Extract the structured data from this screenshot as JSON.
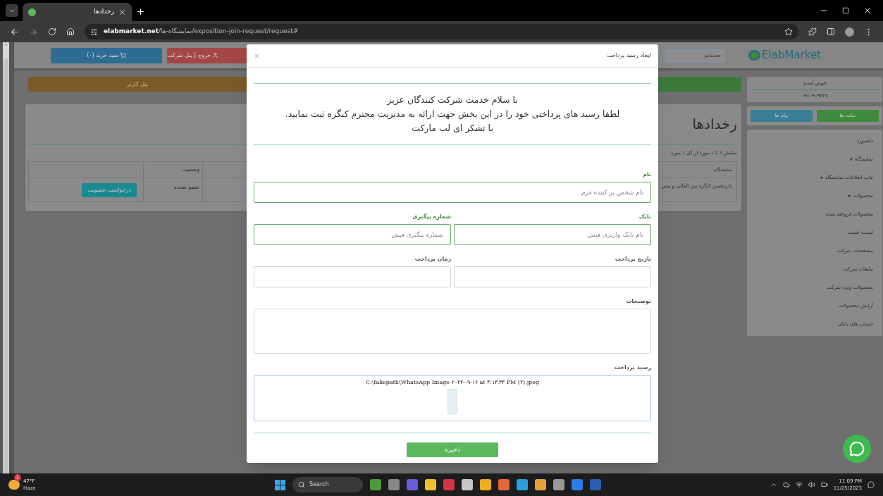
{
  "browser": {
    "tab_title": "رخدادها",
    "url_host": "elabmarket.net",
    "url_path": "/نمایشگاه-ها/exposition-join-request/request#"
  },
  "header": {
    "cart_button": "سبد خرید (۰)",
    "company_button": "خروج | پنل شرکت",
    "search": {
      "placeholder": "جستجو"
    },
    "logo": "ElabMarket"
  },
  "banner": {
    "label": "پنل کاربر"
  },
  "events": {
    "title": "رخدادها",
    "summary": "نمایش ۱ تا ۱ مورد از کل ۱ مورد.",
    "columns": [
      "نمایشگاه",
      "وضعیت"
    ],
    "rows": [
      {
        "status": "عضو نشده",
        "exhibition": "پانزدهمین کنگره بین المللی و بیس",
        "action": "درخواست عضویت"
      }
    ]
  },
  "sidebar": {
    "welcome": "خوش آمدید",
    "phone": "۰۹۱۰۹۰۹۲۲۷",
    "buttons": [
      {
        "label": "تیکت ها",
        "color": "#3f8a3c"
      },
      {
        "label": "پیام ها",
        "color": "#3a7f96"
      }
    ],
    "items": [
      {
        "label": "داشبورد",
        "has_submenu": false
      },
      {
        "label": "نمایشگاه",
        "has_submenu": true
      },
      {
        "label": "چاپ اطلاعات نمایشگاه",
        "has_submenu": true
      },
      {
        "label": "محصولات",
        "has_submenu": true
      },
      {
        "label": "محصولات فروخته شده",
        "has_submenu": false
      },
      {
        "label": "لیست قیمت",
        "has_submenu": false
      },
      {
        "label": "مشخصات شرکت",
        "has_submenu": false
      },
      {
        "label": "تبلیغات شرکت",
        "has_submenu": false
      },
      {
        "label": "محصولات ویژه شرکت",
        "has_submenu": false
      },
      {
        "label": "آرایش محصولات",
        "has_submenu": false
      },
      {
        "label": "حساب های بانکی",
        "has_submenu": false
      }
    ]
  },
  "modal": {
    "title": "ایجاد رسید پرداخت",
    "close": "×",
    "message": [
      "با سلام خدمت شرکت کنندگان عزیز",
      "لطفا رسید های پرداختی خود را در این بخش جهت ارائه به مدیریت محترم کنگره ثبت نمایید.",
      "با تشکر ای لب مارکت"
    ],
    "rows": [
      [
        {
          "kind": "text",
          "label": "نام",
          "placeholder": "نام شخص پر کننده فرم",
          "validated": true
        }
      ],
      [
        {
          "kind": "text",
          "label": "بانک",
          "placeholder": "نام بانک واریزی فیش",
          "validated": true
        },
        {
          "kind": "text",
          "label": "شماره پیگیری",
          "placeholder": "شماره پیگیری فیش",
          "validated": true
        }
      ],
      [
        {
          "kind": "text",
          "label": "تاریخ پرداخت",
          "validated": false
        },
        {
          "kind": "text",
          "label": "زمان پرداخت",
          "validated": false
        }
      ],
      [
        {
          "kind": "textarea",
          "label": "توضیحات",
          "validated": false
        }
      ],
      [
        {
          "kind": "file",
          "label": "رسید پرداخت",
          "value": "C:\\fakepath\\WhatsApp Image ۲۰۲۲-۰۹-۱۶ at ۳.۱۳.۳۳ PM (۲).jpeg",
          "validated": false
        }
      ]
    ],
    "save_button": "ذخیره"
  },
  "taskbar": {
    "weather": {
      "temp": "47°F",
      "condition": "Haze",
      "badge": "1"
    },
    "search": {
      "placeholder": "Search"
    },
    "time": "11:09 PM",
    "date": "11/25/2023"
  }
}
